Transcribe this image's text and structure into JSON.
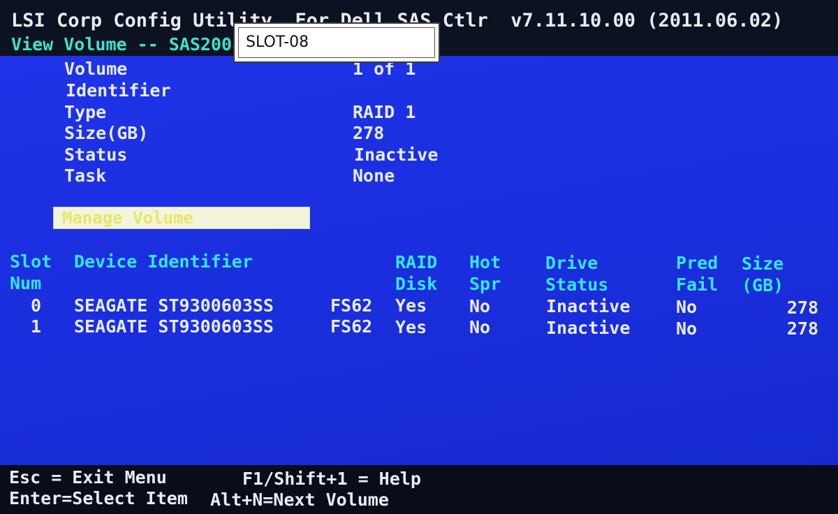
{
  "header": {
    "title": "LSI Corp Config Utility  For Dell SAS Ctlr  v7.11.10.00 (2011.06.02)",
    "subtitle": "View Volume -- SAS2008"
  },
  "popup": {
    "text": "SLOT-08"
  },
  "volume": {
    "fields": [
      {
        "label": "Volume",
        "value": "1 of 1"
      },
      {
        "label": "Identifier",
        "value": ""
      },
      {
        "label": "Type",
        "value": "RAID 1"
      },
      {
        "label": "Size(GB)",
        "value": "278"
      },
      {
        "label": "Status",
        "value": "Inactive"
      },
      {
        "label": "Task",
        "value": "None"
      }
    ]
  },
  "menu": {
    "manage_volume": "Manage Volume"
  },
  "table": {
    "headers": {
      "slot_num": [
        "Slot",
        "Num"
      ],
      "device_identifier": "Device Identifier",
      "raid_disk": [
        "RAID",
        "Disk"
      ],
      "hot_spr": [
        "Hot",
        "Spr"
      ],
      "drive_status": [
        "Drive",
        "Status"
      ],
      "pred_fail": [
        "Pred",
        "Fail"
      ],
      "size_gb": [
        "Size",
        "(GB)"
      ]
    },
    "rows": [
      {
        "slot": "0",
        "device": "SEAGATE ST9300603SS",
        "rev": "FS62",
        "raid": "Yes",
        "hot": "No",
        "status": "Inactive",
        "pred": "No",
        "size": "278"
      },
      {
        "slot": "1",
        "device": "SEAGATE ST9300603SS",
        "rev": "FS62",
        "raid": "Yes",
        "hot": "No",
        "status": "Inactive",
        "pred": "No",
        "size": "278"
      }
    ]
  },
  "footer": {
    "esc": "Esc = Exit Menu",
    "help": "F1/Shift+1 = Help",
    "enter": "Enter=Select Item",
    "next": "Alt+N=Next Volume"
  },
  "colors": {
    "background_blue": "#1f33e8",
    "label_white": "#e8ecf4",
    "header_cyan": "#36e6f0",
    "subtitle_green": "#3ee3c8",
    "highlight_yellow": "#e4e868"
  }
}
